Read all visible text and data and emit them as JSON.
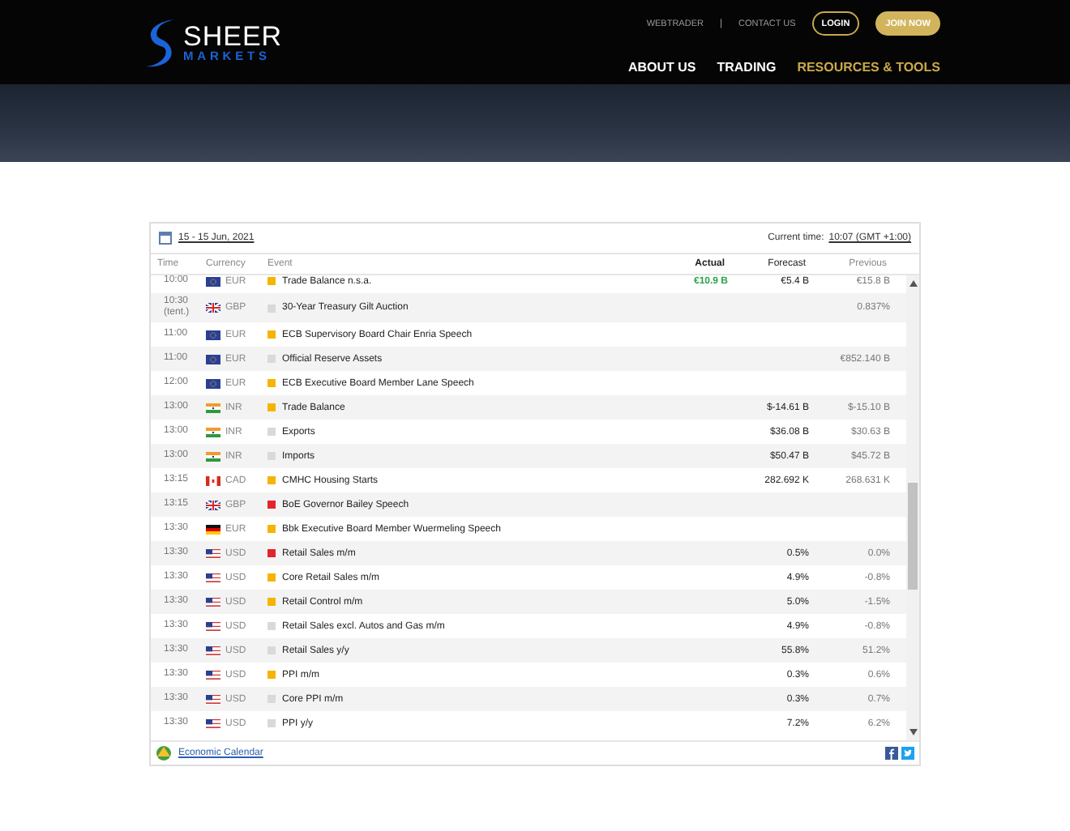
{
  "header": {
    "logo": {
      "name": "SHEER",
      "sub": "MARKETS"
    },
    "top_links": [
      "WEBTRADER",
      "|",
      "CONTACT US"
    ],
    "login": "LOGIN",
    "join": "JOIN NOW",
    "nav": [
      {
        "label": "ABOUT US",
        "selected": false
      },
      {
        "label": "TRADING",
        "selected": false
      },
      {
        "label": "RESOURCES & TOOLS",
        "selected": true
      }
    ]
  },
  "calendar": {
    "date_range": "15 - 15 Jun, 2021",
    "current_time_label": "Current time:",
    "current_time": "10:07 (GMT +1:00)",
    "columns": [
      "Time",
      "Currency",
      "Event",
      "Actual",
      "Forecast",
      "Previous"
    ],
    "rows": [
      {
        "time": "10:00",
        "kind": "eu",
        "currency": "EUR",
        "color": "#f5b400",
        "event": "Trade Balance n.s.a.",
        "actual": "€10.9 B",
        "actual_better": true,
        "forecast": "€5.4 B",
        "previous": "€15.8 B"
      },
      {
        "time": "10:30",
        "time_note": "(tent.)",
        "kind": "gb",
        "currency": "GBP",
        "color": "#d9d9d9",
        "event": "30-Year Treasury Gilt Auction",
        "previous": "0.837%"
      },
      {
        "time": "11:00",
        "kind": "eu",
        "currency": "EUR",
        "color": "#f5b400",
        "event": "ECB Supervisory Board Chair Enria Speech"
      },
      {
        "time": "11:00",
        "kind": "eu",
        "currency": "EUR",
        "color": "#d9d9d9",
        "event": "Official Reserve Assets",
        "previous": "€852.140 B"
      },
      {
        "time": "12:00",
        "kind": "eu",
        "currency": "EUR",
        "color": "#f5b400",
        "event": "ECB Executive Board Member Lane Speech"
      },
      {
        "time": "13:00",
        "kind": "in",
        "currency": "INR",
        "color": "#f5b400",
        "event": "Trade Balance",
        "forecast": "$-14.61 B",
        "previous": "$-15.10 B"
      },
      {
        "time": "13:00",
        "kind": "in",
        "currency": "INR",
        "color": "#d9d9d9",
        "event": "Exports",
        "forecast": "$36.08 B",
        "previous": "$30.63 B"
      },
      {
        "time": "13:00",
        "kind": "in",
        "currency": "INR",
        "color": "#d9d9d9",
        "event": "Imports",
        "forecast": "$50.47 B",
        "previous": "$45.72 B"
      },
      {
        "time": "13:15",
        "kind": "ca",
        "currency": "CAD",
        "color": "#f5b400",
        "event": "CMHC Housing Starts",
        "forecast": "282.692 K",
        "previous": "268.631 K"
      },
      {
        "time": "13:15",
        "kind": "gb",
        "currency": "GBP",
        "color": "#e2252b",
        "event": "BoE Governor Bailey Speech"
      },
      {
        "time": "13:30",
        "kind": "de",
        "currency": "EUR",
        "color": "#f5b400",
        "event": "Bbk Executive Board Member Wuermeling Speech"
      },
      {
        "time": "13:30",
        "kind": "us",
        "currency": "USD",
        "color": "#e2252b",
        "event": "Retail Sales m/m",
        "forecast": "0.5%",
        "previous": "0.0%"
      },
      {
        "time": "13:30",
        "kind": "us",
        "currency": "USD",
        "color": "#f5b400",
        "event": "Core Retail Sales m/m",
        "forecast": "4.9%",
        "previous": "-0.8%"
      },
      {
        "time": "13:30",
        "kind": "us",
        "currency": "USD",
        "color": "#f5b400",
        "event": "Retail Control m/m",
        "forecast": "5.0%",
        "previous": "-1.5%"
      },
      {
        "time": "13:30",
        "kind": "us",
        "currency": "USD",
        "color": "#d9d9d9",
        "event": "Retail Sales excl. Autos and Gas m/m",
        "forecast": "4.9%",
        "previous": "-0.8%"
      },
      {
        "time": "13:30",
        "kind": "us",
        "currency": "USD",
        "color": "#d9d9d9",
        "event": "Retail Sales y/y",
        "forecast": "55.8%",
        "previous": "51.2%"
      },
      {
        "time": "13:30",
        "kind": "us",
        "currency": "USD",
        "color": "#f5b400",
        "event": "PPI m/m",
        "forecast": "0.3%",
        "previous": "0.6%"
      },
      {
        "time": "13:30",
        "kind": "us",
        "currency": "USD",
        "color": "#d9d9d9",
        "event": "Core PPI m/m",
        "forecast": "0.3%",
        "previous": "0.7%"
      },
      {
        "time": "13:30",
        "kind": "us",
        "currency": "USD",
        "color": "#d9d9d9",
        "event": "PPI y/y",
        "forecast": "7.2%",
        "previous": "6.2%"
      }
    ],
    "footer_link": "Economic Calendar"
  }
}
